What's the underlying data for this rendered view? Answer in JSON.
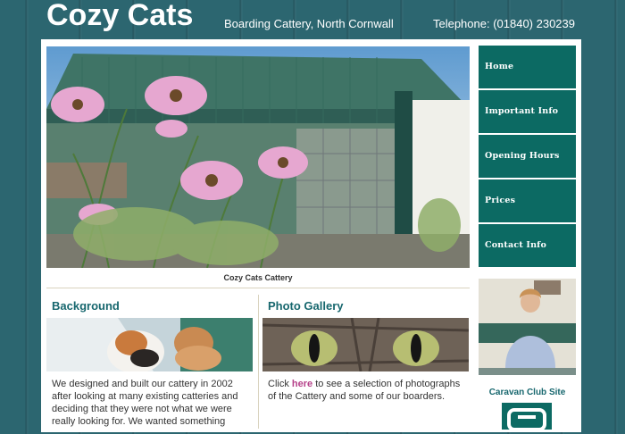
{
  "header": {
    "site_title": "Cozy Cats",
    "tagline": "Boarding Cattery, North Cornwall",
    "phone": "Telephone: (01840) 230239"
  },
  "hero": {
    "caption": "Cozy Cats Cattery"
  },
  "nav": {
    "items": [
      {
        "label": "Home"
      },
      {
        "label": "Important Info"
      },
      {
        "label": "Opening Hours"
      },
      {
        "label": "Prices"
      },
      {
        "label": "Contact Info"
      }
    ]
  },
  "background_section": {
    "title": "Background",
    "text": "We designed and built our cattery in 2002 after looking at many existing catteries and deciding that they were not what we were really looking for. We wanted something"
  },
  "gallery_section": {
    "title": "Photo Gallery",
    "text_before": "Click ",
    "link_text": "here",
    "text_after": " to see a selection of photographs of the Cattery and some of our boarders."
  },
  "sidebar": {
    "caravan_title": "Caravan Club Site"
  },
  "colors": {
    "background": "#2c6670",
    "nav": "#0c6a63",
    "heading": "#17676e",
    "link": "#b6428a"
  }
}
